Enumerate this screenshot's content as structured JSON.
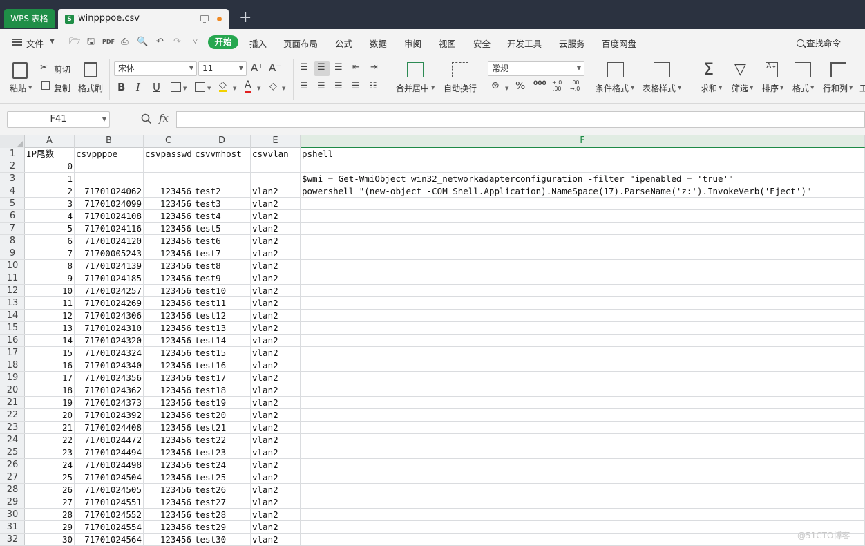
{
  "tabs": {
    "app_tab": "WPS 表格",
    "doc_tab": "winpppoe.csv",
    "file_icon": "S",
    "add_tab": "+"
  },
  "menu": {
    "file": "文件",
    "start": "开始",
    "items": [
      "插入",
      "页面布局",
      "公式",
      "数据",
      "审阅",
      "视图",
      "安全",
      "开发工具",
      "云服务",
      "百度网盘"
    ],
    "search": "查找命令"
  },
  "ribbon": {
    "paste": "粘贴",
    "cut": "剪切",
    "copy": "复制",
    "format_painter": "格式刷",
    "font_name": "宋体",
    "font_size": "11",
    "bold": "B",
    "italic": "I",
    "underline": "U",
    "font_color_letter": "A",
    "merge_center": "合并居中",
    "auto_wrap": "自动换行",
    "number_format": "常规",
    "percent": "%",
    "thousands": "000",
    "inc_decimal": "+.0\n.00",
    "dec_decimal": ".00\n→.0",
    "conditional_format": "条件格式",
    "table_style": "表格样式",
    "sum": "求和",
    "filter": "筛选",
    "sort": "排序",
    "format": "格式",
    "row_col": "行和列",
    "more": "工"
  },
  "formula_bar": {
    "cell_ref": "F41",
    "fx": "fx",
    "value": ""
  },
  "sheet": {
    "columns": [
      "A",
      "B",
      "C",
      "D",
      "E",
      "F"
    ],
    "active_column": "F",
    "rows": [
      {
        "n": "1",
        "A": "IP尾数",
        "B": "csvpppoe",
        "C": "csvpasswd",
        "D": "csvvmhost",
        "E": "csvvlan",
        "F": "pshell"
      },
      {
        "n": "2",
        "A": "0",
        "B": "",
        "C": "",
        "D": "",
        "E": "",
        "F": ""
      },
      {
        "n": "3",
        "A": "1",
        "B": "",
        "C": "",
        "D": "",
        "E": "",
        "F": "$wmi = Get-WmiObject win32_networkadapterconfiguration -filter \"ipenabled = 'true'\""
      },
      {
        "n": "4",
        "A": "2",
        "B": "71701024062",
        "C": "123456",
        "D": "test2",
        "E": "vlan2",
        "F": "powershell \"(new-object -COM Shell.Application).NameSpace(17).ParseName('z:').InvokeVerb('Eject')\""
      },
      {
        "n": "5",
        "A": "3",
        "B": "71701024099",
        "C": "123456",
        "D": "test3",
        "E": "vlan2",
        "F": ""
      },
      {
        "n": "6",
        "A": "4",
        "B": "71701024108",
        "C": "123456",
        "D": "test4",
        "E": "vlan2",
        "F": ""
      },
      {
        "n": "7",
        "A": "5",
        "B": "71701024116",
        "C": "123456",
        "D": "test5",
        "E": "vlan2",
        "F": ""
      },
      {
        "n": "8",
        "A": "6",
        "B": "71701024120",
        "C": "123456",
        "D": "test6",
        "E": "vlan2",
        "F": ""
      },
      {
        "n": "9",
        "A": "7",
        "B": "71700005243",
        "C": "123456",
        "D": "test7",
        "E": "vlan2",
        "F": ""
      },
      {
        "n": "10",
        "A": "8",
        "B": "71701024139",
        "C": "123456",
        "D": "test8",
        "E": "vlan2",
        "F": ""
      },
      {
        "n": "11",
        "A": "9",
        "B": "71701024185",
        "C": "123456",
        "D": "test9",
        "E": "vlan2",
        "F": ""
      },
      {
        "n": "12",
        "A": "10",
        "B": "71701024257",
        "C": "123456",
        "D": "test10",
        "E": "vlan2",
        "F": ""
      },
      {
        "n": "13",
        "A": "11",
        "B": "71701024269",
        "C": "123456",
        "D": "test11",
        "E": "vlan2",
        "F": ""
      },
      {
        "n": "14",
        "A": "12",
        "B": "71701024306",
        "C": "123456",
        "D": "test12",
        "E": "vlan2",
        "F": ""
      },
      {
        "n": "15",
        "A": "13",
        "B": "71701024310",
        "C": "123456",
        "D": "test13",
        "E": "vlan2",
        "F": ""
      },
      {
        "n": "16",
        "A": "14",
        "B": "71701024320",
        "C": "123456",
        "D": "test14",
        "E": "vlan2",
        "F": ""
      },
      {
        "n": "17",
        "A": "15",
        "B": "71701024324",
        "C": "123456",
        "D": "test15",
        "E": "vlan2",
        "F": ""
      },
      {
        "n": "18",
        "A": "16",
        "B": "71701024340",
        "C": "123456",
        "D": "test16",
        "E": "vlan2",
        "F": ""
      },
      {
        "n": "19",
        "A": "17",
        "B": "71701024356",
        "C": "123456",
        "D": "test17",
        "E": "vlan2",
        "F": ""
      },
      {
        "n": "20",
        "A": "18",
        "B": "71701024362",
        "C": "123456",
        "D": "test18",
        "E": "vlan2",
        "F": ""
      },
      {
        "n": "21",
        "A": "19",
        "B": "71701024373",
        "C": "123456",
        "D": "test19",
        "E": "vlan2",
        "F": ""
      },
      {
        "n": "22",
        "A": "20",
        "B": "71701024392",
        "C": "123456",
        "D": "test20",
        "E": "vlan2",
        "F": ""
      },
      {
        "n": "23",
        "A": "21",
        "B": "71701024408",
        "C": "123456",
        "D": "test21",
        "E": "vlan2",
        "F": ""
      },
      {
        "n": "24",
        "A": "22",
        "B": "71701024472",
        "C": "123456",
        "D": "test22",
        "E": "vlan2",
        "F": ""
      },
      {
        "n": "25",
        "A": "23",
        "B": "71701024494",
        "C": "123456",
        "D": "test23",
        "E": "vlan2",
        "F": ""
      },
      {
        "n": "26",
        "A": "24",
        "B": "71701024498",
        "C": "123456",
        "D": "test24",
        "E": "vlan2",
        "F": ""
      },
      {
        "n": "27",
        "A": "25",
        "B": "71701024504",
        "C": "123456",
        "D": "test25",
        "E": "vlan2",
        "F": ""
      },
      {
        "n": "28",
        "A": "26",
        "B": "71701024505",
        "C": "123456",
        "D": "test26",
        "E": "vlan2",
        "F": ""
      },
      {
        "n": "29",
        "A": "27",
        "B": "71701024551",
        "C": "123456",
        "D": "test27",
        "E": "vlan2",
        "F": ""
      },
      {
        "n": "30",
        "A": "28",
        "B": "71701024552",
        "C": "123456",
        "D": "test28",
        "E": "vlan2",
        "F": ""
      },
      {
        "n": "31",
        "A": "29",
        "B": "71701024554",
        "C": "123456",
        "D": "test29",
        "E": "vlan2",
        "F": ""
      },
      {
        "n": "32",
        "A": "30",
        "B": "71701024564",
        "C": "123456",
        "D": "test30",
        "E": "vlan2",
        "F": ""
      }
    ]
  },
  "watermark": "@51CTO博客",
  "colors": {
    "accent_green": "#1f8e47",
    "start_button": "#26a74f",
    "titlebar": "#2b3240"
  }
}
